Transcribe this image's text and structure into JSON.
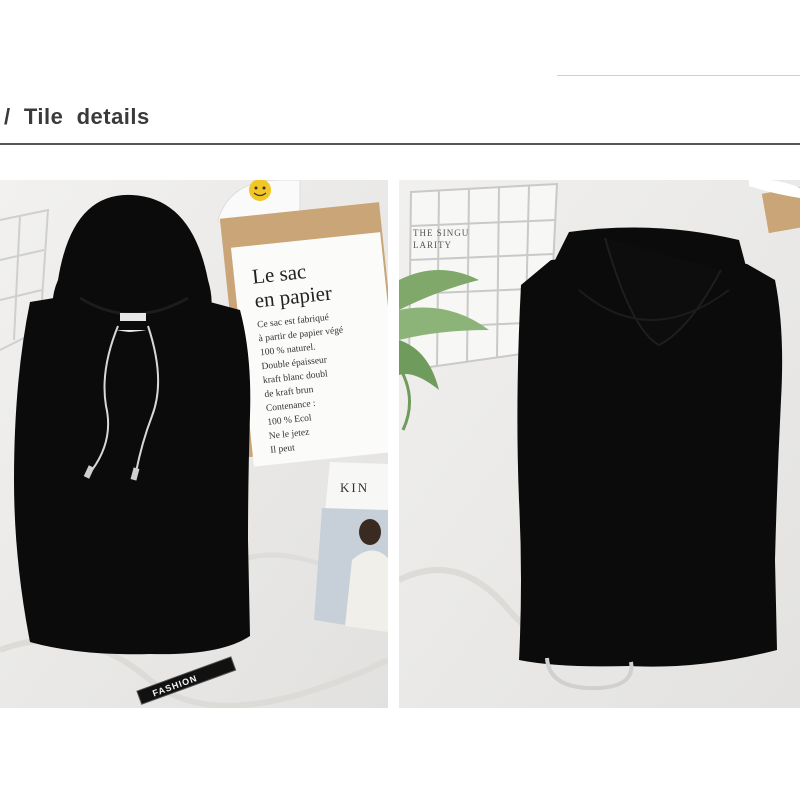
{
  "section": {
    "title": "/  Tile  details"
  },
  "photos": {
    "front": {
      "paper_title_line1": "Le sac",
      "paper_title_line2": "en papier",
      "paper_body": [
        "Ce sac est fabriqué",
        "à partir de papier végé",
        "100 % naturel.",
        "Double épaisseur",
        "kraft blanc doubl",
        "de kraft brun",
        "Contenance :",
        "100 % Ecol",
        "Ne le jetez",
        "Il peut"
      ],
      "magazine_title": "KIN",
      "strap_text": "FASHION"
    },
    "back": {
      "grid_text_line1": "THE SINGU",
      "grid_text_line2": "LARITY"
    }
  },
  "colors": {
    "garment": "#0b0b0b",
    "background": "#ecebe9",
    "title_text": "#3a3a3a"
  }
}
